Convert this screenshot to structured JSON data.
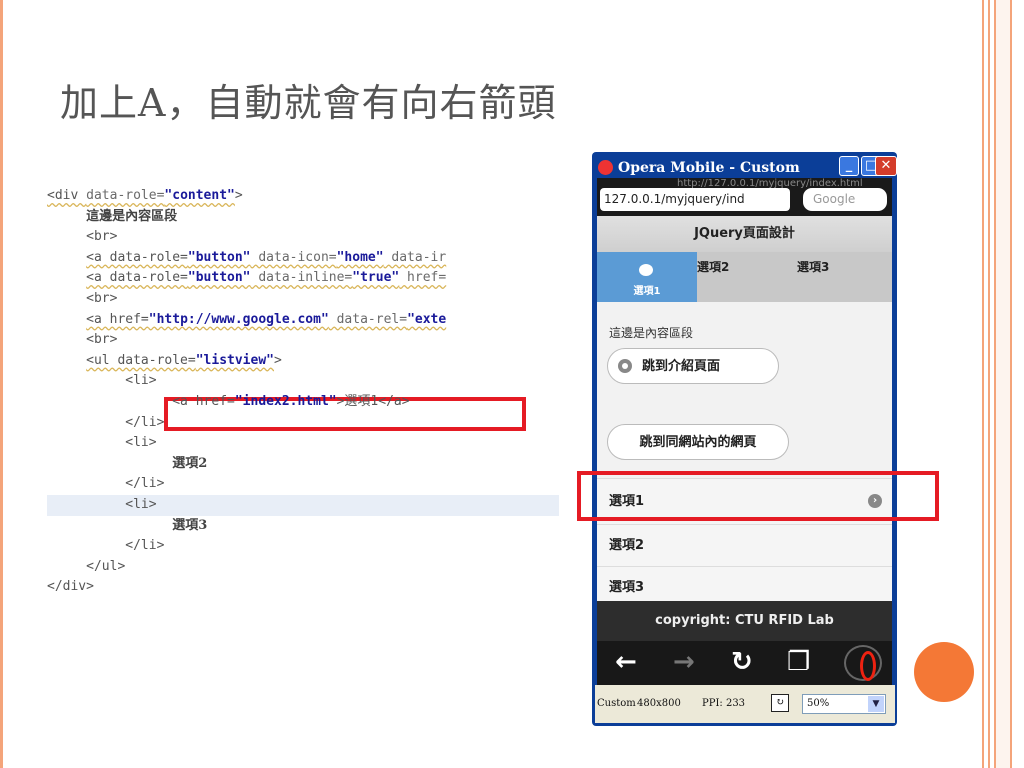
{
  "slide": {
    "title": "加上A，自動就會有向右箭頭",
    "accent_color": "#f47836",
    "highlight_color": "#e51b24"
  },
  "code": {
    "lines": [
      [
        "<div ",
        "data-role=",
        "\"content\"",
        ">"
      ],
      [
        "這邊是內容區段"
      ],
      [
        "<br>"
      ],
      [
        "<a data-role=",
        "\"button\"",
        " data-icon=",
        "\"home\"",
        " data-ir"
      ],
      [
        "<a data-role=",
        "\"button\"",
        " data-inline=",
        "\"true\"",
        " href="
      ],
      [
        "<br>"
      ],
      [
        "<a href=",
        "\"http://www.google.com\"",
        " data-rel=",
        "\"exte"
      ],
      [
        "<br>"
      ],
      [
        "<ul data-role=",
        "\"listview\"",
        ">"
      ],
      [
        "<li>"
      ],
      [
        "<a href=",
        "\"index2.html\"",
        ">選項1</a>"
      ],
      [
        "</li>"
      ],
      [
        "<li>"
      ],
      [
        "選項2"
      ],
      [
        "</li>"
      ],
      [
        "<li>"
      ],
      [
        "選項3"
      ],
      [
        "</li>"
      ],
      [
        "</ul>"
      ],
      [
        "</div>"
      ]
    ]
  },
  "browser": {
    "window_title": "Opera Mobile - Custom",
    "faint_url": "http://127.0.0.1/myjquery/index.html",
    "url": "127.0.0.1/myjquery/ind",
    "search_placeholder": "Google",
    "page_header": "JQuery頁面設計",
    "nav": [
      {
        "label": "選項1"
      },
      {
        "label": "選項2"
      },
      {
        "label": "選項3"
      }
    ],
    "content_text": "這邊是內容區段",
    "button1": "跳到介紹頁面",
    "button2": "跳到同網站內的網頁",
    "list": [
      {
        "label": "選項1"
      },
      {
        "label": "選項2"
      },
      {
        "label": "選項3"
      }
    ],
    "footer": "copyright: CTU RFID Lab",
    "status": {
      "profile": "Custom",
      "resolution": "480x800",
      "ppi": "PPI: 233",
      "zoom": "50%"
    }
  }
}
